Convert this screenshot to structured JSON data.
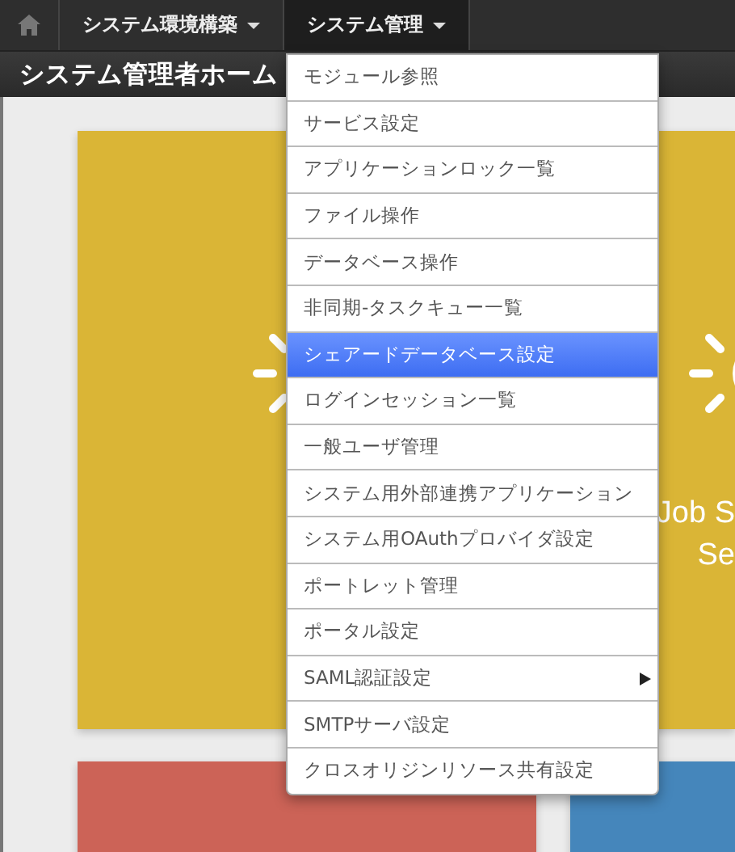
{
  "navbar": {
    "tabs": [
      {
        "label": "システム環境構築",
        "selected": false
      },
      {
        "label": "システム管理",
        "selected": true
      }
    ]
  },
  "page_title": "システム管理者ホーム",
  "tiles": [
    {
      "color": "#dab536"
    },
    {
      "color": "#dab536",
      "lines": [
        "Job S",
        "Se"
      ]
    },
    {
      "color": "#cc6357"
    },
    {
      "color": "#4586bb"
    }
  ],
  "menu": {
    "items": [
      {
        "label": "モジュール参照",
        "selected": false,
        "has_submenu": false
      },
      {
        "label": "サービス設定",
        "selected": false,
        "has_submenu": false
      },
      {
        "label": "アプリケーションロック一覧",
        "selected": false,
        "has_submenu": false
      },
      {
        "label": "ファイル操作",
        "selected": false,
        "has_submenu": false
      },
      {
        "label": "データベース操作",
        "selected": false,
        "has_submenu": false
      },
      {
        "label": "非同期-タスクキュー一覧",
        "selected": false,
        "has_submenu": false
      },
      {
        "label": "シェアードデータベース設定",
        "selected": true,
        "has_submenu": false
      },
      {
        "label": "ログインセッション一覧",
        "selected": false,
        "has_submenu": false
      },
      {
        "label": "一般ユーザ管理",
        "selected": false,
        "has_submenu": false
      },
      {
        "label": "システム用外部連携アプリケーション",
        "selected": false,
        "has_submenu": false
      },
      {
        "label": "システム用OAuthプロバイダ設定",
        "selected": false,
        "has_submenu": false
      },
      {
        "label": "ポートレット管理",
        "selected": false,
        "has_submenu": false
      },
      {
        "label": "ポータル設定",
        "selected": false,
        "has_submenu": false
      },
      {
        "label": "SAML認証設定",
        "selected": false,
        "has_submenu": true
      },
      {
        "label": "SMTPサーバ設定",
        "selected": false,
        "has_submenu": false
      },
      {
        "label": "クロスオリジンリソース共有設定",
        "selected": false,
        "has_submenu": false
      }
    ]
  }
}
